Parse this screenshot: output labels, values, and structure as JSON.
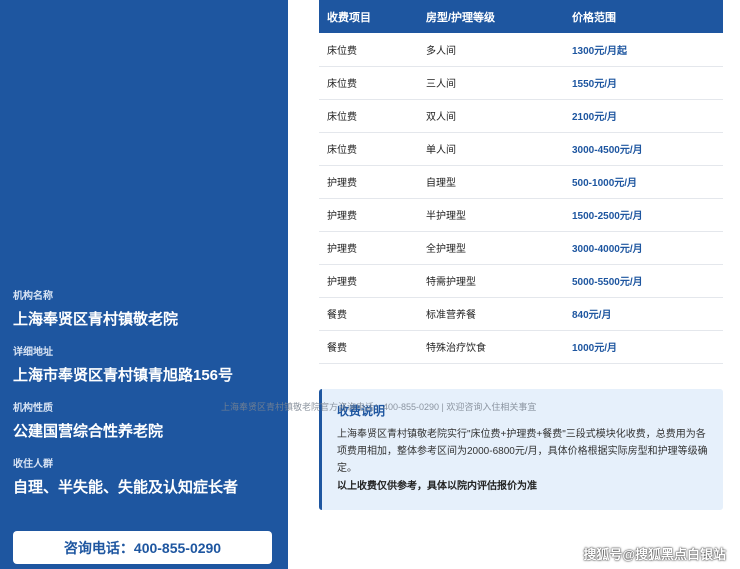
{
  "left": {
    "blocks": [
      {
        "label": "机构名称",
        "value": "上海奉贤区青村镇敬老院"
      },
      {
        "label": "详细地址",
        "value": "上海市奉贤区青村镇青旭路156号"
      },
      {
        "label": "机构性质",
        "value": "公建国营综合性养老院"
      },
      {
        "label": "收住人群",
        "value": "自理、半失能、失能及认知症长者"
      }
    ],
    "consult_button": "咨询电话：400-855-0290"
  },
  "table": {
    "headers": [
      "收费项目",
      "房型/护理等级",
      "价格范围"
    ],
    "rows": [
      [
        "床位费",
        "多人间",
        "1300元/月起"
      ],
      [
        "床位费",
        "三人间",
        "1550元/月"
      ],
      [
        "床位费",
        "双人间",
        "2100元/月"
      ],
      [
        "床位费",
        "单人间",
        "3000-4500元/月"
      ],
      [
        "护理费",
        "自理型",
        "500-1000元/月"
      ],
      [
        "护理费",
        "半护理型",
        "1500-2500元/月"
      ],
      [
        "护理费",
        "全护理型",
        "3000-4000元/月"
      ],
      [
        "护理费",
        "特需护理型",
        "5000-5500元/月"
      ],
      [
        "餐费",
        "标准营养餐",
        "840元/月"
      ],
      [
        "餐费",
        "特殊治疗饮食",
        "1000元/月"
      ]
    ]
  },
  "note": {
    "title": "收费说明",
    "text": "上海奉贤区青村镇敬老院实行\"床位费+护理费+餐费\"三段式模块化收费，总费用为各项费用相加，整体参考区间为2000-6800元/月，具体价格根据实际房型和护理等级确定。",
    "strong": "以上收费仅供参考，具体以院内评估报价为准"
  },
  "overlay_line": "上海奉贤区青村镇敬老院官方咨询电话：400-855-0290 | 欢迎咨询入住相关事宜",
  "watermark": "搜狐号@搜狐黑点白银站"
}
